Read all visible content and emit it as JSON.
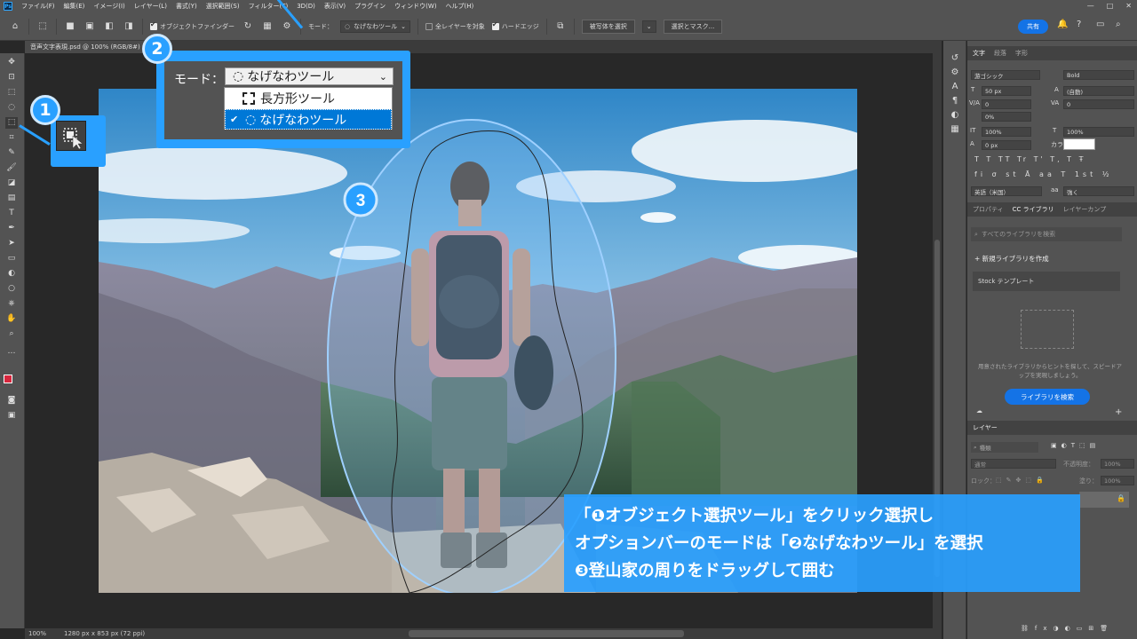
{
  "menu": {
    "app_icon": "Ps",
    "items": [
      "ファイル(F)",
      "編集(E)",
      "イメージ(I)",
      "レイヤー(L)",
      "書式(Y)",
      "選択範囲(S)",
      "フィルター(T)",
      "3D(D)",
      "表示(V)",
      "プラグイン",
      "ウィンドウ(W)",
      "ヘルプ(H)"
    ]
  },
  "options": {
    "object_finder": "オブジェクトファインダー",
    "mode_label": "モード：",
    "mode_value": "なげなわツール",
    "all_layers": "全レイヤーを対象",
    "hard_edge": "ハードエッジ",
    "select_subject": "被写体を選択",
    "select_mask": "選択とマスク...",
    "share": "共有"
  },
  "document": {
    "tab": "音声文字表現.psd @ 100% (RGB/8#)",
    "zoom": "100%",
    "size": "1280 px x 853 px (72 ppi)"
  },
  "callouts": {
    "badge1": "1",
    "badge2": "2",
    "badge3": "3",
    "mode_label": "モード：",
    "mode_value": "なげなわツール",
    "option_rect": "長方形ツール",
    "option_lasso": "なげなわツール"
  },
  "instructions": {
    "line1": "「❶オブジェクト選択ツール」をクリック選択し",
    "line2": "オプションバーのモードは「❷なげなわツール」を選択",
    "line3": "❸登山家の周りをドラッグして囲む"
  },
  "panel_char": {
    "tabs": [
      "文字",
      "段落",
      "字形"
    ],
    "font": "游ゴシック",
    "style": "Bold",
    "size": "50 px",
    "leading": "(自動)",
    "kerning": "0",
    "tracking": "0",
    "scale_pct": "0%",
    "vscale": "100%",
    "hscale": "100%",
    "baseline": "0 px",
    "color_label": "カラー：",
    "lang": "英語（米国）",
    "aa": "強く"
  },
  "panel_lib": {
    "tabs": [
      "プロパティ",
      "CC ライブラリ",
      "レイヤーカンプ"
    ],
    "search_placeholder": "すべてのライブラリを検索",
    "new_library": "新規ライブラリを作成",
    "stock": "Stock テンプレート",
    "hint": "用意されたライブラリからヒントを探して、スピードアップを実現しましょう。",
    "search_btn": "ライブラリを検索"
  },
  "panel_layers": {
    "tab": "レイヤー",
    "kind": "種類",
    "blend": "通常",
    "opacity_label": "不透明度：",
    "opacity": "100%",
    "lock_label": "ロック：",
    "fill_label": "塗り：",
    "fill": "100%"
  },
  "colors": {
    "accent": "#29a0ff",
    "ps_bg": "#535353",
    "canvas": "#282828",
    "foreground": "#d7263d"
  }
}
